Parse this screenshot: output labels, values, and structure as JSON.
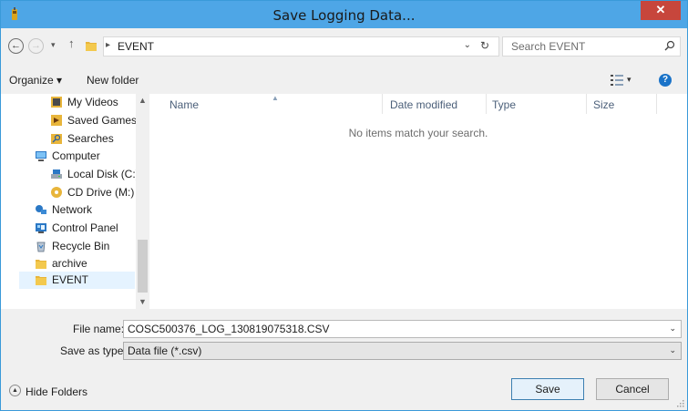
{
  "window": {
    "title": "Save Logging Data...",
    "close_label": "✕"
  },
  "address": {
    "current_folder": "EVENT",
    "separator": "▸",
    "dropdown": "⌄",
    "refresh": "↻"
  },
  "search": {
    "placeholder": "Search EVENT"
  },
  "toolbar": {
    "organize_label": "Organize ▾",
    "new_folder_label": "New folder",
    "view_dd": "▾",
    "help_label": "?"
  },
  "nav": {
    "items": [
      {
        "label": "My Videos",
        "icon": "videos-folder-icon"
      },
      {
        "label": "Saved Games",
        "icon": "saved-games-icon"
      },
      {
        "label": "Searches",
        "icon": "searches-icon"
      },
      {
        "label": "Computer",
        "icon": "computer-icon"
      },
      {
        "label": "Local Disk (C:)",
        "icon": "local-disk-icon"
      },
      {
        "label": "CD Drive (M:)",
        "icon": "cd-drive-icon"
      },
      {
        "label": "Network",
        "icon": "network-icon"
      },
      {
        "label": "Control Panel",
        "icon": "control-panel-icon"
      },
      {
        "label": "Recycle Bin",
        "icon": "recycle-bin-icon"
      },
      {
        "label": "archive",
        "icon": "folder-icon"
      },
      {
        "label": "EVENT",
        "icon": "folder-icon",
        "selected": true
      }
    ]
  },
  "columns": {
    "name": "Name",
    "date_modified": "Date modified",
    "type": "Type",
    "size": "Size"
  },
  "empty_message": "No items match your search.",
  "form": {
    "file_name_label": "File name:",
    "file_name_value": "COSC500376_LOG_130819075318.CSV",
    "save_type_label": "Save as type:",
    "save_type_value": "Data file (*.csv)"
  },
  "footer": {
    "hide_folders_label": "Hide Folders",
    "save_label": "Save",
    "cancel_label": "Cancel"
  },
  "colors": {
    "titlebar": "#4ea6e6",
    "close": "#c7463c",
    "selection": "#e5f3ff",
    "accent_border": "#3c7fb1"
  }
}
